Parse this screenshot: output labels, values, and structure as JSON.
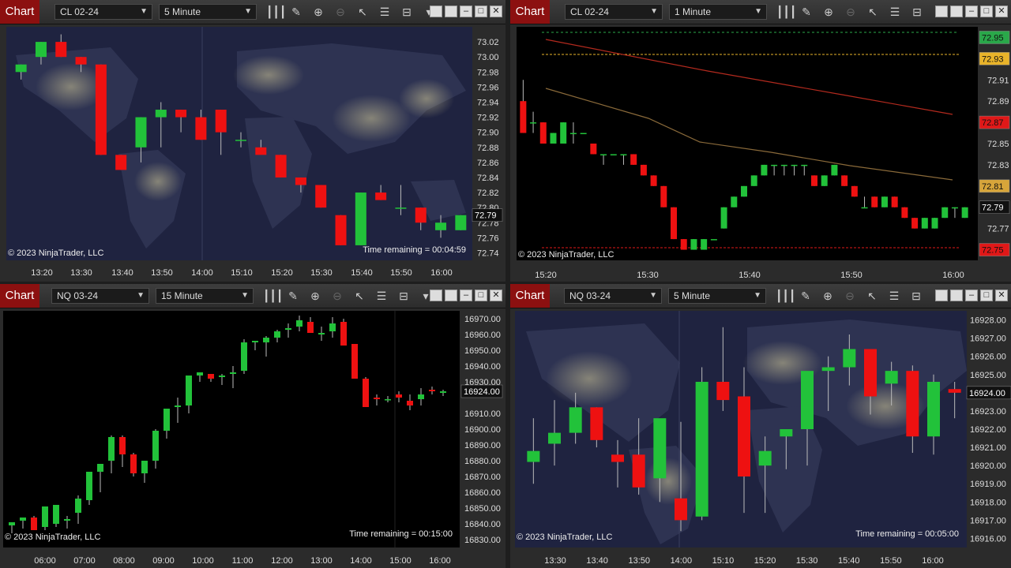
{
  "panels": [
    {
      "tab": "Chart",
      "instrument": "CL 02-24",
      "interval": "5 Minute",
      "copyright": "© 2023 NinjaTrader, LLC",
      "time_remaining": "Time remaining = 00:04:59",
      "price_labels": [
        "73.02",
        "73.00",
        "72.98",
        "72.96",
        "72.94",
        "72.92",
        "72.90",
        "72.88",
        "72.86",
        "72.84",
        "72.82",
        "72.80",
        "72.78",
        "72.76",
        "72.74"
      ],
      "time_labels": [
        "13:20",
        "13:30",
        "13:40",
        "13:50",
        "14:00",
        "15:10",
        "15:20",
        "15:30",
        "15:40",
        "15:50",
        "16:00"
      ],
      "last_price": "72.79"
    },
    {
      "tab": "Chart",
      "instrument": "CL 02-24",
      "interval": "1 Minute",
      "copyright": "© 2023 NinjaTrader, LLC",
      "price_labels": [
        "72.91",
        "72.89",
        "72.85",
        "72.83",
        "72.77"
      ],
      "time_labels": [
        "15:20",
        "15:30",
        "15:40",
        "15:50",
        "16:00"
      ],
      "markers": [
        {
          "text": "72.95",
          "color": "#2aa84a"
        },
        {
          "text": "72.93",
          "color": "#e8b32a"
        },
        {
          "text": "72.87",
          "color": "#e01818"
        },
        {
          "text": "72.81",
          "color": "#d7a53a"
        },
        {
          "text": "72.79",
          "color": "#111111"
        },
        {
          "text": "72.75",
          "color": "#e01818"
        }
      ]
    },
    {
      "tab": "Chart",
      "instrument": "NQ 03-24",
      "interval": "15 Minute",
      "copyright": "© 2023 NinjaTrader, LLC",
      "time_remaining": "Time remaining = 00:15:00",
      "price_labels": [
        "16970.00",
        "16960.00",
        "16950.00",
        "16940.00",
        "16930.00",
        "16910.00",
        "16900.00",
        "16890.00",
        "16880.00",
        "16870.00",
        "16860.00",
        "16850.00",
        "16840.00",
        "16830.00"
      ],
      "time_labels": [
        "06:00",
        "07:00",
        "08:00",
        "09:00",
        "10:00",
        "11:00",
        "12:00",
        "13:00",
        "14:00",
        "15:00",
        "16:00"
      ],
      "last_price": "16924.00"
    },
    {
      "tab": "Chart",
      "instrument": "NQ 03-24",
      "interval": "5 Minute",
      "copyright": "© 2023 NinjaTrader, LLC",
      "time_remaining": "Time remaining = 00:05:00",
      "price_labels": [
        "16928.00",
        "16927.00",
        "16926.00",
        "16925.00",
        "16923.00",
        "16922.00",
        "16921.00",
        "16920.00",
        "16919.00",
        "16918.00",
        "16917.00",
        "16916.00"
      ],
      "time_labels": [
        "13:30",
        "13:40",
        "13:50",
        "14:00",
        "15:10",
        "15:20",
        "15:30",
        "15:40",
        "15:50",
        "16:00"
      ],
      "last_price": "16924.00"
    }
  ],
  "toolbar_icons": [
    "bar-type-icon",
    "pencil-icon",
    "zoom-in-icon",
    "zoom-out-icon",
    "pointer-icon",
    "properties-icon",
    "templates-icon",
    "dropdown-arrow-icon"
  ],
  "colors": {
    "up": "#22c23a",
    "down": "#ee1111",
    "chart_tab": "#8c1010",
    "map_bg": "#1f2340"
  },
  "chart_data": [
    {
      "type": "candlestick",
      "instrument": "CL 02-24",
      "interval": "5 Minute",
      "ylim": [
        72.73,
        73.04
      ],
      "x": [
        "13:20",
        "13:25",
        "13:30",
        "13:35",
        "13:40",
        "13:45",
        "13:50",
        "13:55",
        "14:00",
        "14:05",
        "15:10",
        "15:15",
        "15:20",
        "15:25",
        "15:30",
        "15:35",
        "15:40",
        "15:45",
        "15:50",
        "15:55",
        "16:00",
        "16:05"
      ],
      "ohlc": [
        [
          72.98,
          72.99,
          72.97,
          72.99
        ],
        [
          73.0,
          73.02,
          72.99,
          73.02
        ],
        [
          73.02,
          73.03,
          73.0,
          73.0
        ],
        [
          73.0,
          73.0,
          72.98,
          72.99
        ],
        [
          72.99,
          72.99,
          72.87,
          72.87
        ],
        [
          72.87,
          72.87,
          72.85,
          72.85
        ],
        [
          72.88,
          72.92,
          72.86,
          72.92
        ],
        [
          72.92,
          72.94,
          72.88,
          72.93
        ],
        [
          72.93,
          72.93,
          72.9,
          72.92
        ],
        [
          72.92,
          72.93,
          72.89,
          72.89
        ],
        [
          72.93,
          72.93,
          72.87,
          72.9
        ],
        [
          72.89,
          72.9,
          72.88,
          72.89
        ],
        [
          72.88,
          72.89,
          72.88,
          72.87
        ],
        [
          72.87,
          72.87,
          72.84,
          72.84
        ],
        [
          72.84,
          72.84,
          72.82,
          72.83
        ],
        [
          72.83,
          72.83,
          72.8,
          72.8
        ],
        [
          72.79,
          72.79,
          72.75,
          72.75
        ],
        [
          72.75,
          72.82,
          72.75,
          72.82
        ],
        [
          72.82,
          72.83,
          72.81,
          72.81
        ],
        [
          72.8,
          72.83,
          72.79,
          72.8
        ],
        [
          72.8,
          72.8,
          72.77,
          72.78
        ],
        [
          72.77,
          72.79,
          72.76,
          72.78
        ],
        [
          72.77,
          72.79,
          72.77,
          72.79
        ]
      ]
    },
    {
      "type": "candlestick",
      "instrument": "CL 02-24",
      "interval": "1 Minute",
      "ylim": [
        72.74,
        72.96
      ],
      "x_range": [
        "15:17",
        "16:01"
      ],
      "ohlc": [
        [
          72.89,
          72.91,
          72.86,
          72.86
        ],
        [
          72.87,
          72.88,
          72.86,
          72.87
        ],
        [
          72.87,
          72.87,
          72.85,
          72.85
        ],
        [
          72.85,
          72.86,
          72.85,
          72.86
        ],
        [
          72.85,
          72.87,
          72.85,
          72.87
        ],
        [
          72.86,
          72.87,
          72.85,
          72.86
        ],
        [
          72.86,
          72.86,
          72.86,
          72.86
        ],
        [
          72.85,
          72.85,
          72.84,
          72.84
        ],
        [
          72.84,
          72.84,
          72.83,
          72.84
        ],
        [
          72.84,
          72.84,
          72.84,
          72.84
        ],
        [
          72.84,
          72.84,
          72.83,
          72.84
        ],
        [
          72.84,
          72.84,
          72.83,
          72.83
        ],
        [
          72.83,
          72.83,
          72.82,
          72.82
        ],
        [
          72.82,
          72.82,
          72.81,
          72.81
        ],
        [
          72.81,
          72.81,
          72.79,
          72.79
        ],
        [
          72.79,
          72.79,
          72.76,
          72.76
        ],
        [
          72.76,
          72.76,
          72.75,
          72.75
        ],
        [
          72.75,
          72.76,
          72.75,
          72.76
        ],
        [
          72.75,
          72.76,
          72.75,
          72.76
        ],
        [
          72.76,
          72.76,
          72.76,
          72.76
        ],
        [
          72.77,
          72.79,
          72.77,
          72.79
        ],
        [
          72.79,
          72.8,
          72.79,
          72.8
        ],
        [
          72.8,
          72.81,
          72.8,
          72.81
        ],
        [
          72.81,
          72.82,
          72.81,
          72.82
        ],
        [
          72.82,
          72.83,
          72.82,
          72.83
        ],
        [
          72.83,
          72.83,
          72.82,
          72.83
        ],
        [
          72.83,
          72.83,
          72.82,
          72.83
        ],
        [
          72.83,
          72.83,
          72.82,
          72.83
        ],
        [
          72.83,
          72.83,
          72.82,
          72.83
        ],
        [
          72.82,
          72.82,
          72.81,
          72.81
        ],
        [
          72.81,
          72.82,
          72.81,
          72.82
        ],
        [
          72.82,
          72.83,
          72.82,
          72.83
        ],
        [
          72.82,
          72.82,
          72.81,
          72.81
        ],
        [
          72.81,
          72.81,
          72.8,
          72.8
        ],
        [
          72.79,
          72.8,
          72.79,
          72.79
        ],
        [
          72.8,
          72.8,
          72.79,
          72.79
        ],
        [
          72.79,
          72.8,
          72.79,
          72.8
        ],
        [
          72.8,
          72.8,
          72.79,
          72.79
        ],
        [
          72.79,
          72.79,
          72.78,
          72.78
        ],
        [
          72.78,
          72.78,
          72.77,
          72.77
        ],
        [
          72.77,
          72.78,
          72.77,
          72.78
        ],
        [
          72.77,
          72.78,
          72.77,
          72.78
        ],
        [
          72.78,
          72.79,
          72.78,
          72.79
        ],
        [
          72.79,
          72.79,
          72.78,
          72.79
        ],
        [
          72.78,
          72.79,
          72.78,
          72.79
        ]
      ]
    },
    {
      "type": "candlestick",
      "instrument": "NQ 03-24",
      "interval": "15 Minute",
      "ylim": [
        16825,
        16975
      ],
      "x_range": [
        "05:30",
        "16:15"
      ],
      "ohlc": [
        [
          16839,
          16841,
          16834,
          16841
        ],
        [
          16842,
          16843,
          16837,
          16844
        ],
        [
          16844,
          16845,
          16838,
          16836
        ],
        [
          16838,
          16851,
          16836,
          16851
        ],
        [
          16840,
          16852,
          16838,
          16852
        ],
        [
          16842,
          16845,
          16837,
          16843
        ],
        [
          16847,
          16858,
          16840,
          16856
        ],
        [
          16855,
          16870,
          16852,
          16873
        ],
        [
          16873,
          16878,
          16860,
          16878
        ],
        [
          16880,
          16896,
          16872,
          16895
        ],
        [
          16895,
          16896,
          16876,
          16884
        ],
        [
          16884,
          16885,
          16870,
          16872
        ],
        [
          16872,
          16880,
          16866,
          16880
        ],
        [
          16880,
          16900,
          16875,
          16899
        ],
        [
          16899,
          16912,
          16894,
          16913
        ],
        [
          16914,
          16920,
          16904,
          16915
        ],
        [
          16915,
          16934,
          16910,
          16934
        ],
        [
          16934,
          16935,
          16930,
          16936
        ],
        [
          16935,
          16935,
          16930,
          16932
        ],
        [
          16933,
          16935,
          16928,
          16934
        ],
        [
          16935,
          16940,
          16926,
          16936
        ],
        [
          16937,
          16957,
          16935,
          16955
        ],
        [
          16955,
          16956,
          16950,
          16956
        ],
        [
          16955,
          16959,
          16946,
          16958
        ],
        [
          16958,
          16963,
          16955,
          16962
        ],
        [
          16963,
          16967,
          16958,
          16964
        ],
        [
          16965,
          16972,
          16962,
          16969
        ],
        [
          16968,
          16971,
          16964,
          16961
        ],
        [
          16960,
          16965,
          16956,
          16961
        ],
        [
          16962,
          16971,
          16958,
          16967
        ],
        [
          16968,
          16970,
          16955,
          16953
        ],
        [
          16954,
          16954,
          16935,
          16932
        ],
        [
          16932,
          16933,
          16915,
          16914
        ],
        [
          16920,
          16922,
          16915,
          16919
        ],
        [
          16919,
          16921,
          16917,
          16919
        ],
        [
          16922,
          16924,
          16917,
          16920
        ],
        [
          16918,
          16922,
          16912,
          16915
        ],
        [
          16919,
          16926,
          16915,
          16922
        ],
        [
          16925,
          16927,
          16922,
          16924
        ],
        [
          16923,
          16925,
          16921,
          16924
        ]
      ]
    },
    {
      "type": "candlestick",
      "instrument": "NQ 03-24",
      "interval": "5 Minute",
      "ylim": [
        16915.5,
        16928.5
      ],
      "x": [
        "13:25",
        "13:30",
        "13:35",
        "13:40",
        "13:45",
        "13:50",
        "13:55",
        "14:00",
        "14:05",
        "15:05",
        "15:10",
        "15:15",
        "15:20",
        "15:25",
        "15:30",
        "15:35",
        "15:40",
        "15:45",
        "15:50",
        "15:55",
        "16:00",
        "16:05"
      ],
      "ohlc": [
        [
          16920.2,
          16922.6,
          16919.0,
          16920.8
        ],
        [
          16921.2,
          16923.6,
          16920.0,
          16921.8
        ],
        [
          16921.8,
          16924.0,
          16921.2,
          16923.2
        ],
        [
          16923.2,
          16923.2,
          16921.0,
          16921.4
        ],
        [
          16920.6,
          16921.4,
          16918.8,
          16920.2
        ],
        [
          16920.6,
          16922.6,
          16918.4,
          16918.8
        ],
        [
          16919.3,
          16922.3,
          16918.0,
          16922.6
        ],
        [
          16918.2,
          16922.4,
          16916.4,
          16917.0
        ],
        [
          16917.2,
          16925.4,
          16917.0,
          16924.6
        ],
        [
          16924.6,
          16927.6,
          16923.0,
          16923.6
        ],
        [
          16923.8,
          16925.4,
          16917.4,
          16919.4
        ],
        [
          16920.0,
          16921.6,
          16917.4,
          16920.8
        ],
        [
          16921.6,
          16922.0,
          16919.8,
          16922.0
        ],
        [
          16922.0,
          16923.8,
          16920.0,
          16925.2
        ],
        [
          16925.2,
          16926.0,
          16923.0,
          16925.4
        ],
        [
          16925.4,
          16927.2,
          16924.4,
          16926.4
        ],
        [
          16926.4,
          16926.4,
          16922.8,
          16923.8
        ],
        [
          16924.5,
          16925.7,
          16923.3,
          16925.2
        ],
        [
          16925.2,
          16925.5,
          16920.7,
          16921.6
        ],
        [
          16921.6,
          16925.0,
          16920.6,
          16924.6
        ],
        [
          16924.2,
          16924.6,
          16922.6,
          16924.0
        ]
      ]
    }
  ]
}
